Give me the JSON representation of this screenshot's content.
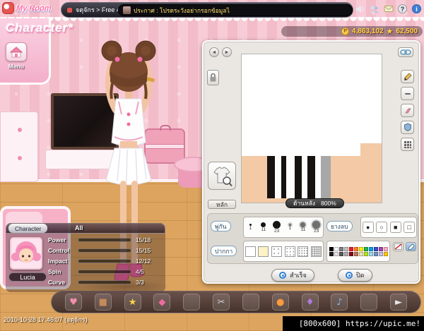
{
  "topbar": {
    "logo": "My Room",
    "nav_text": "จตุจักร > Free 4",
    "announcement": "ประกาศ : โปรดระวังอย่ากรอกข้อมูลไ",
    "icons": {
      "help": "?",
      "info": "i"
    }
  },
  "header": {
    "title": "Character*",
    "currency": {
      "coin_symbol": "P",
      "coin_amount": "4,863,102",
      "star_symbol": "★",
      "star_amount": "62,500"
    }
  },
  "menu_button": {
    "label": "Menu"
  },
  "editor": {
    "nav_prev": "◄",
    "nav_next": "►",
    "main_tab_label": "หลัก",
    "view_label": "ด้านหลัง",
    "zoom_level": "800%",
    "brush_label": "พู่กัน",
    "pen_label": "ปากกา",
    "eraser_label": "ยางลบ",
    "brush_sizes": [
      "1",
      "11",
      "23",
      "1",
      "11",
      "23"
    ],
    "shape_tools": [
      "●",
      "○",
      "■",
      "□"
    ],
    "pen_swatches": [
      "solid-white",
      "solid-cream",
      "dots-sparse",
      "dots-light",
      "dots-medium",
      "dots-dense"
    ],
    "palette_row1": [
      "#000000",
      "#ffffff",
      "#7f7f7f",
      "#c3c3c3",
      "#ed1c24",
      "#ff7f27",
      "#fff200",
      "#22b14c",
      "#00a2e8",
      "#3f48cc",
      "#a349a4",
      "#ffaec9"
    ],
    "palette_row2": [
      "#1a1a1a",
      "#e5e5e5",
      "#595959",
      "#b0b0b0",
      "#880015",
      "#b97a57",
      "#efe4b0",
      "#b5e61d",
      "#99d9ea",
      "#7092be",
      "#c8bfe7",
      "#ffc90e"
    ],
    "done_button": "สำเร็จ",
    "close_button": "ปิด"
  },
  "stats_panel": {
    "tab_label": "Character",
    "filter_label": "All",
    "character_name": "Lucia",
    "stats": [
      {
        "label": "Power",
        "value": "15/18",
        "pct": "83%",
        "color": "#e8403a"
      },
      {
        "label": "Control",
        "value": "15/15",
        "pct": "100%",
        "color": "#8bc34a"
      },
      {
        "label": "Impact",
        "value": "12/12",
        "pct": "100%",
        "color": "#2ab5a5"
      },
      {
        "label": "Spin",
        "value": "4/5",
        "pct": "80%",
        "color": "#3f8fe0"
      },
      {
        "label": "Curve",
        "value": "3/3",
        "pct": "100%",
        "color": "#b05fd6"
      }
    ]
  },
  "hotbar": {
    "slots": [
      {
        "name": "item-outfit",
        "glyph": "♥",
        "color": "#f48fb1"
      },
      {
        "name": "item-box",
        "glyph": "■",
        "color": "#c58a5a"
      },
      {
        "name": "item-star",
        "glyph": "★",
        "color": "#ffd24a"
      },
      {
        "name": "item-gem",
        "glyph": "◆",
        "color": "#f06ba0"
      },
      {
        "name": "empty-slot",
        "glyph": "",
        "color": ""
      },
      {
        "name": "item-scissors",
        "glyph": "✂",
        "color": "#cfd2d8"
      },
      {
        "name": "empty-slot",
        "glyph": "",
        "color": ""
      },
      {
        "name": "item-ball",
        "glyph": "●",
        "color": "#ff9a3d"
      },
      {
        "name": "item-charm",
        "glyph": "♦",
        "color": "#b07ae0"
      },
      {
        "name": "item-music",
        "glyph": "♪",
        "color": "#7ab8f0"
      },
      {
        "name": "empty-slot",
        "glyph": "",
        "color": ""
      },
      {
        "name": "expand-button",
        "glyph": "►",
        "color": "#e8e8e8"
      }
    ]
  },
  "footer": {
    "timestamp": "2010-10-28 17:46:07 (จตุจักร)",
    "watermark": "[800x600] https://upic.me!"
  }
}
